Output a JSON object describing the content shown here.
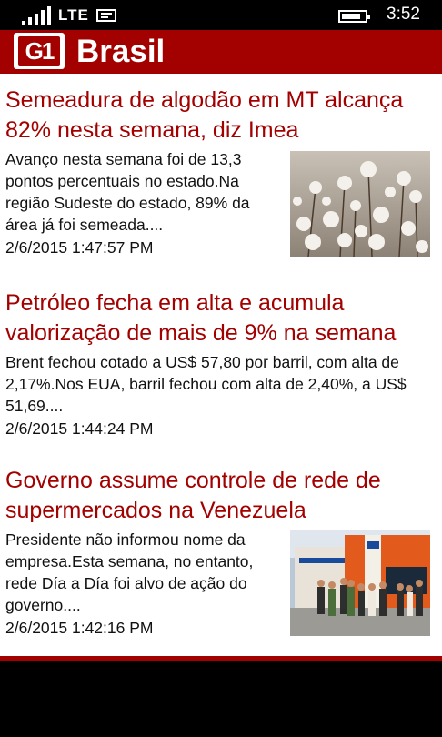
{
  "status": {
    "network": "LTE",
    "time": "3:52"
  },
  "app": {
    "title": "Brasil",
    "logo_text": "G1",
    "accent_color": "#a30000"
  },
  "articles": [
    {
      "headline": "Semeadura de algodão em MT alcança 82% nesta semana, diz Imea",
      "summary": "Avanço nesta semana foi de 13,3 pontos percentuais no estado.Na região Sudeste do estado, 89% da área já foi semeada....",
      "date": "2/6/2015 1:47:57 PM",
      "image": "cotton-plants-photo"
    },
    {
      "headline": "Petróleo fecha em alta e acumula valorização de mais de 9% na semana",
      "summary": "Brent fechou cotado a US$ 57,80 por barril, com alta de 2,17%.Nos EUA, barril  fechou com alta de 2,40%, a US$ 51,69....",
      "date": "2/6/2015 1:44:24 PM"
    },
    {
      "headline": "Governo assume controle de rede de supermercados na Venezuela",
      "summary": "Presidente não informou nome da empresa.Esta semana, no entanto, rede Día a Día foi alvo de ação do governo....",
      "date": "2/6/2015 1:42:16 PM",
      "image": "supermarket-storefront-photo"
    }
  ]
}
